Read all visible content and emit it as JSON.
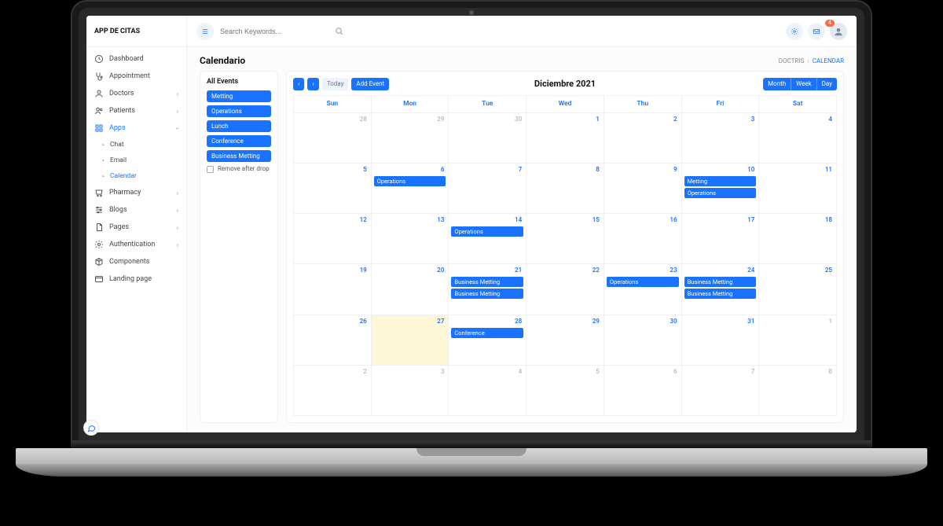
{
  "brand": "APP DE CITAS",
  "topbar": {
    "search_placeholder": "Search Keywords...",
    "badge": "4"
  },
  "breadcrumb": {
    "root": "DOCTRIS",
    "current": "CALENDAR"
  },
  "page_title": "Calendario",
  "sidebar": {
    "dashboard": "Dashboard",
    "appointment": "Appointment",
    "doctors": "Doctors",
    "patients": "Patients",
    "apps": "Apps",
    "apps_chat": "Chat",
    "apps_email": "Email",
    "apps_calendar": "Calendar",
    "pharmacy": "Pharmacy",
    "blogs": "Blogs",
    "pages": "Pages",
    "authentication": "Authentication",
    "components": "Components",
    "landing": "Landing page"
  },
  "events_panel": {
    "title": "All Events",
    "items": [
      "Metting",
      "Operations",
      "Lunch",
      "Conference",
      "Business Metting"
    ],
    "remove_label": "Remove after drop"
  },
  "calendar": {
    "nav_prev": "‹",
    "nav_next": "›",
    "today": "Today",
    "add": "Add Event",
    "title": "Diciembre 2021",
    "view_month": "Month",
    "view_week": "Week",
    "view_day": "Day",
    "dow": [
      "Sun",
      "Mon",
      "Tue",
      "Wed",
      "Thu",
      "Fri",
      "Sat"
    ],
    "days": [
      {
        "n": 28,
        "other": true
      },
      {
        "n": 29,
        "other": true
      },
      {
        "n": 30,
        "other": true
      },
      {
        "n": 1
      },
      {
        "n": 2
      },
      {
        "n": 3
      },
      {
        "n": 4
      },
      {
        "n": 5
      },
      {
        "n": 6,
        "events": [
          "Operations"
        ]
      },
      {
        "n": 7
      },
      {
        "n": 8
      },
      {
        "n": 9
      },
      {
        "n": 10,
        "events": [
          "Metting",
          "Operations"
        ]
      },
      {
        "n": 11
      },
      {
        "n": 12
      },
      {
        "n": 13
      },
      {
        "n": 14,
        "events": [
          "Operations"
        ]
      },
      {
        "n": 15
      },
      {
        "n": 16
      },
      {
        "n": 17
      },
      {
        "n": 18
      },
      {
        "n": 19
      },
      {
        "n": 20
      },
      {
        "n": 21,
        "events": [
          "Business Metting",
          "Business Metting"
        ]
      },
      {
        "n": 22
      },
      {
        "n": 23,
        "events": [
          "Operations"
        ]
      },
      {
        "n": 24,
        "events": [
          "Business Metting",
          "Business Metting"
        ]
      },
      {
        "n": 25
      },
      {
        "n": 26
      },
      {
        "n": 27,
        "today": true
      },
      {
        "n": 28,
        "events": [
          "Conference"
        ]
      },
      {
        "n": 29
      },
      {
        "n": 30
      },
      {
        "n": 31
      },
      {
        "n": 1,
        "other": true
      },
      {
        "n": 2,
        "other": true
      },
      {
        "n": 3,
        "other": true
      },
      {
        "n": 4,
        "other": true
      },
      {
        "n": 5,
        "other": true
      },
      {
        "n": 6,
        "other": true
      },
      {
        "n": 7,
        "other": true
      },
      {
        "n": 8,
        "other": true
      }
    ]
  }
}
